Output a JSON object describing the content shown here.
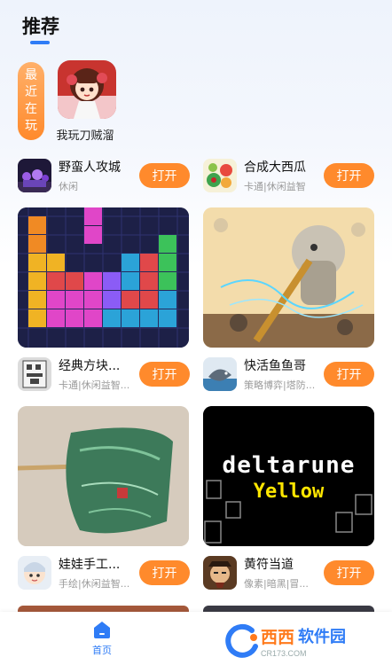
{
  "header": {
    "title": "推荐"
  },
  "recent": {
    "tag_chars": [
      "最",
      "近",
      "在",
      "玩"
    ],
    "game": {
      "name": "我玩刀贼溜",
      "icon": "anime-girl-game-icon"
    }
  },
  "rows": [
    {
      "left": {
        "name": "野蛮人攻城",
        "tags": "休闲",
        "button": "打开",
        "icon": "barbarian-siege-icon"
      },
      "right": {
        "name": "合成大西瓜",
        "tags": "卡通|休闲益智",
        "button": "打开",
        "icon": "watermelon-icon"
      }
    },
    {
      "left": {
        "name": "经典方块...",
        "tags": "卡通|休闲益智...",
        "button": "打开",
        "icon": "tetris-icon"
      },
      "right": {
        "name": "快活鱼鱼哥",
        "tags": "策略博弈|塔防...",
        "button": "打开",
        "icon": "fish-icon"
      }
    },
    {
      "left": {
        "name": "娃娃手工...",
        "tags": "手绘|休闲益智...",
        "button": "打开",
        "icon": "doll-craft-icon"
      },
      "right": {
        "name": "黄符当道",
        "tags": "像素|暗黑|冒...",
        "button": "打开",
        "icon": "taoist-icon"
      }
    }
  ],
  "cards": {
    "deltarune_title": "deltarune",
    "deltarune_subtitle": "Yellow"
  },
  "bottom_nav": {
    "home_label": "首页"
  },
  "watermark": {
    "text1": "西西",
    "text2": "软件园",
    "sub": "CR173.COM"
  },
  "colors": {
    "accent": "#ff8a2c",
    "primary": "#2f7cf6"
  }
}
